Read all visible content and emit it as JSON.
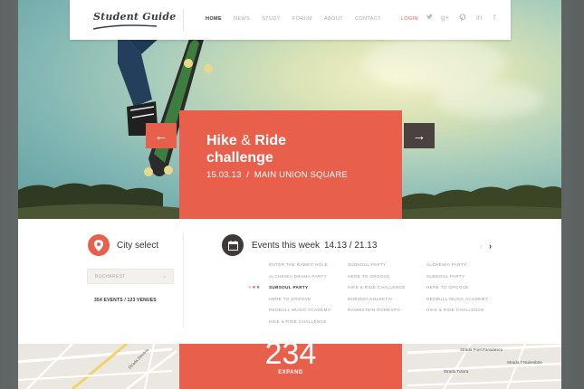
{
  "logo": {
    "text": "Student Guide"
  },
  "nav": {
    "links": [
      {
        "label": "HOME",
        "active": true
      },
      {
        "label": "NEWS",
        "active": false
      },
      {
        "label": "STUDY",
        "active": false
      },
      {
        "label": "FORUM",
        "active": false
      },
      {
        "label": "ABOUT",
        "active": false
      },
      {
        "label": "CONTACT",
        "active": false
      }
    ],
    "login": "LOGIN",
    "social": [
      "twitter-icon",
      "google-plus-icon",
      "pinterest-icon",
      "linkedin-icon",
      "facebook-icon"
    ]
  },
  "hero": {
    "title_part1": "Hike",
    "title_amp": "&",
    "title_part2": "Ride",
    "title_line2": "challenge",
    "subtitle": "15.03.13  /  MAIN UNION SQUARE",
    "prev_icon": "arrow-left-icon",
    "next_icon": "arrow-right-icon"
  },
  "city": {
    "title": "City select",
    "selected": "BUCHAREST",
    "counts": "354 EVENTS / 123 VENUES"
  },
  "events": {
    "title": "Events this week",
    "range": "14.13 / 21.13",
    "col1": [
      "ENTER THE RABBIT HOLE",
      "ALCHEMIA DRAMA PARTY",
      "SUBSOUL PARTY",
      "HERE TO GROOVE",
      "REDBULL MUSIC ACADEMY",
      "HIKE & RIDE CHALLENGE"
    ],
    "col2": [
      "SUBSOUL PARTY",
      "HERE TO GROOVE",
      "HIKE & RIDE CHALLENGE",
      "DUBIOZA KOLEKTIV",
      "RAMMSTEIN ROMEXPO"
    ],
    "col3": [
      "ALCHEMIA PARTY",
      "SUBSOUL PARTY",
      "HERE TO GROOVE",
      "REDBULL MUSIC ACADEMY",
      "HIKE & RIDE CHALLENGE"
    ],
    "highlighted": "SUBSOUL PARTY"
  },
  "map": {
    "number": "234",
    "expand": "EXPAND",
    "streets": [
      "Strada Dimitrie",
      "Strada Poet Panaitescu",
      "Strada Tutora",
      "Strada 7 Noiembrie"
    ]
  },
  "colors": {
    "accent": "#e8604c",
    "dark": "#3e3936"
  }
}
